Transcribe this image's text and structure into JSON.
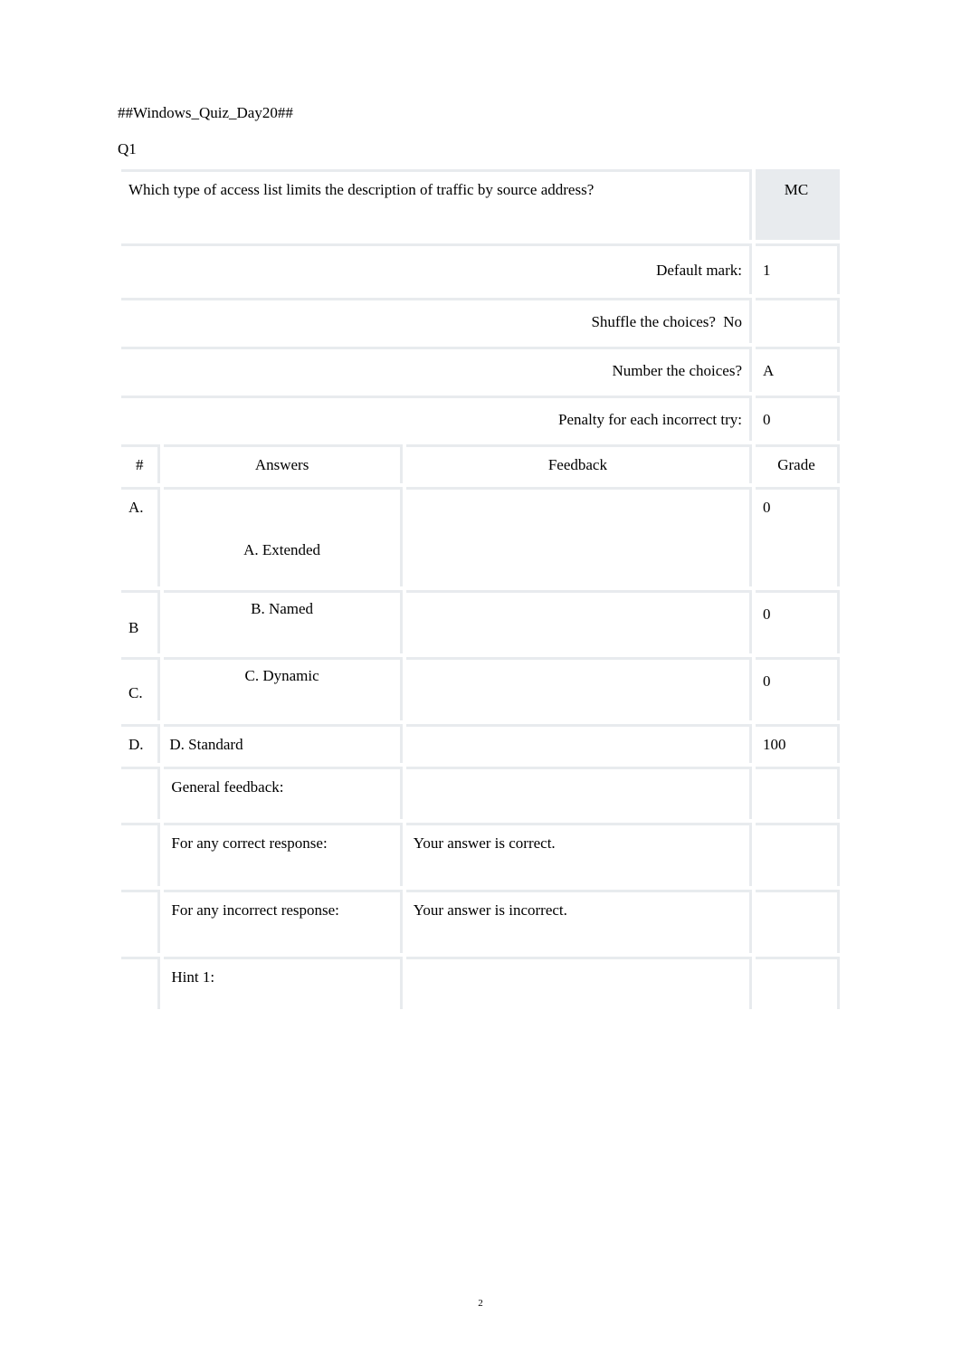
{
  "doc_title": "##Windows_Quiz_Day20##",
  "question_id": "Q1",
  "question_text": "Which type of access list limits the description of traffic by source address?",
  "question_type": "MC",
  "settings": {
    "default_mark_label": "Default mark:",
    "default_mark_value": "1",
    "shuffle_label": "Shuffle the choices?",
    "shuffle_value": "No",
    "number_label": "Number the choices?",
    "number_value": "A",
    "penalty_label": "Penalty for each incorrect try:",
    "penalty_value": "0"
  },
  "headers": {
    "num": "#",
    "answers": "Answers",
    "feedback": "Feedback",
    "grade": "Grade"
  },
  "answers": [
    {
      "letter": "A.",
      "text": "A. Extended",
      "feedback": "",
      "grade": "0"
    },
    {
      "letter": "B",
      "text": "B. Named",
      "feedback": "",
      "grade": "0"
    },
    {
      "letter": "C.",
      "text": "C. Dynamic",
      "feedback": "",
      "grade": "0"
    },
    {
      "letter": "D.",
      "text": "D. Standard",
      "feedback": "",
      "grade": "100"
    }
  ],
  "feedback_rows": {
    "general_label": "General feedback:",
    "general_value": "",
    "correct_label": "For any correct response:",
    "correct_value": "Your answer is correct.",
    "incorrect_label": "For any incorrect response:",
    "incorrect_value": "Your answer is incorrect.",
    "hint1_label": "Hint 1:",
    "hint1_value": ""
  },
  "page_number": "2"
}
